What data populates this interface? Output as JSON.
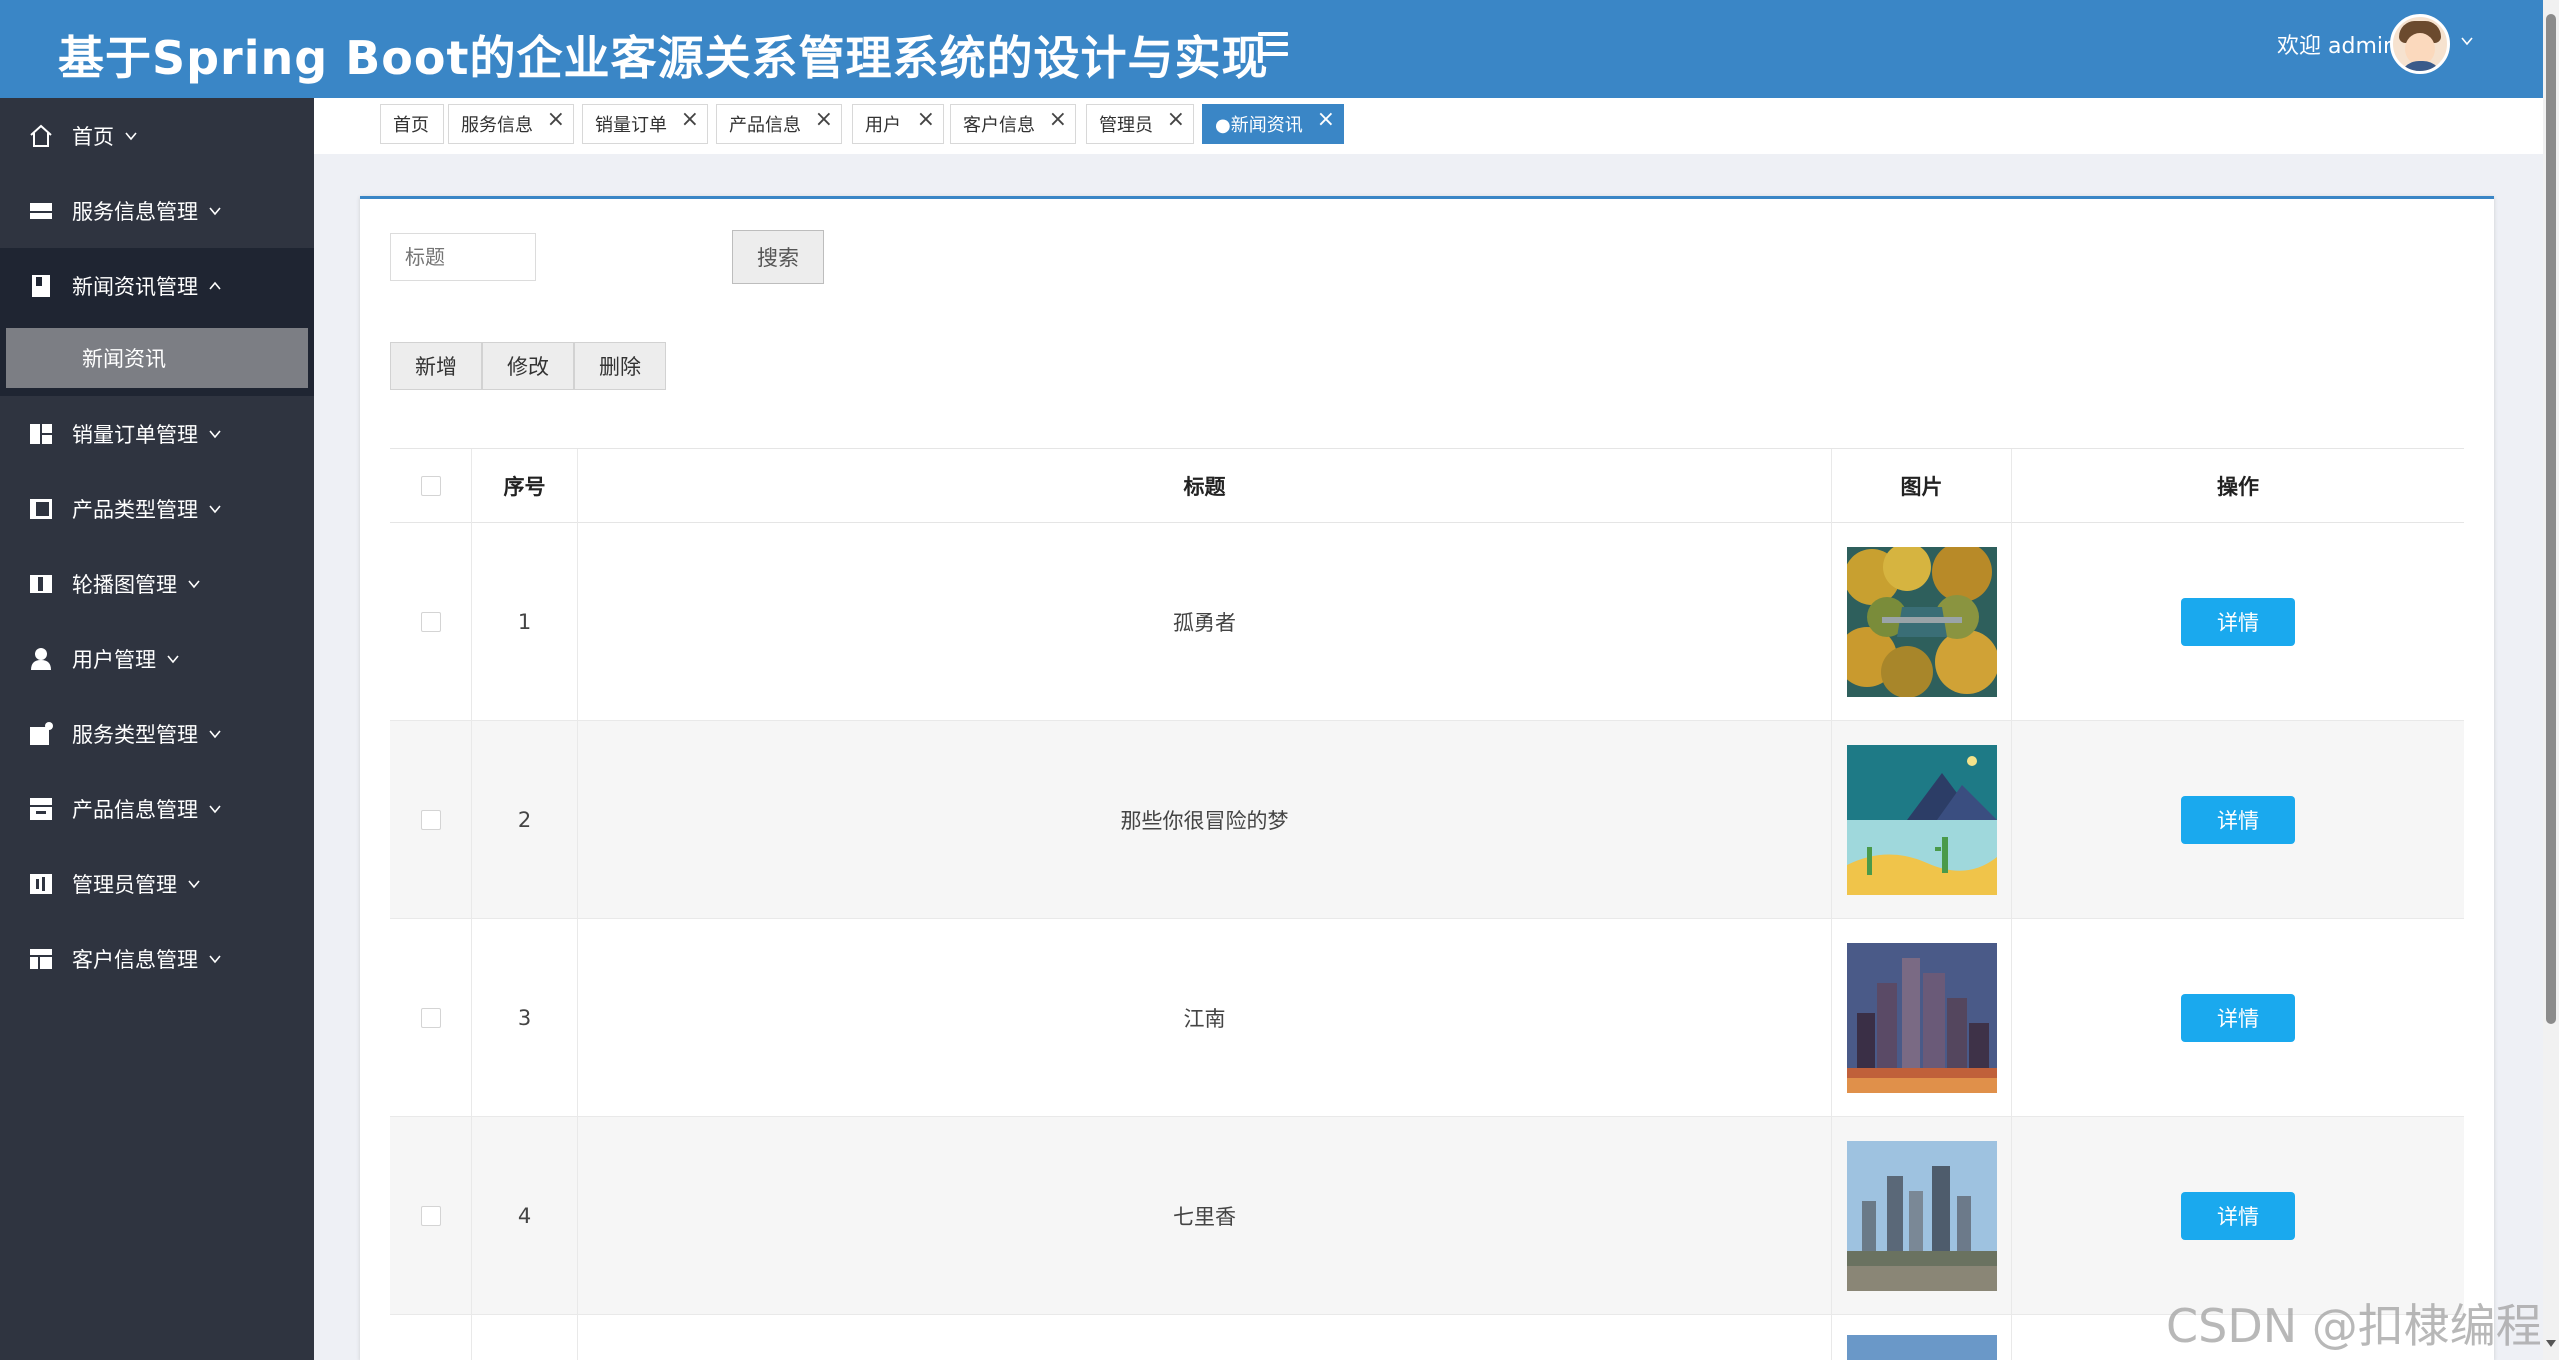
{
  "header": {
    "title": "基于Spring Boot的企业客源关系管理系统的设计与实现",
    "welcome": "欢迎 admin"
  },
  "sidebar": {
    "items": [
      {
        "label": "首页",
        "icon": "home-icon"
      },
      {
        "label": "服务信息管理",
        "icon": "service-info-icon"
      },
      {
        "label": "新闻资讯管理",
        "icon": "news-icon"
      },
      {
        "label": "销量订单管理",
        "icon": "order-icon"
      },
      {
        "label": "产品类型管理",
        "icon": "product-type-icon"
      },
      {
        "label": "轮播图管理",
        "icon": "carousel-icon"
      },
      {
        "label": "用户管理",
        "icon": "user-icon"
      },
      {
        "label": "服务类型管理",
        "icon": "service-type-icon"
      },
      {
        "label": "产品信息管理",
        "icon": "product-info-icon"
      },
      {
        "label": "管理员管理",
        "icon": "admin-icon"
      },
      {
        "label": "客户信息管理",
        "icon": "customer-icon"
      }
    ],
    "sub_item": "新闻资讯"
  },
  "tabs": [
    {
      "label": "首页"
    },
    {
      "label": "服务信息"
    },
    {
      "label": "销量订单"
    },
    {
      "label": "产品信息"
    },
    {
      "label": "用户"
    },
    {
      "label": "客户信息"
    },
    {
      "label": "管理员"
    },
    {
      "label": "●新闻资讯"
    }
  ],
  "search": {
    "placeholder": "标题",
    "button": "搜索"
  },
  "actions": {
    "add": "新增",
    "edit": "修改",
    "delete": "删除"
  },
  "table": {
    "headers": [
      "序号",
      "标题",
      "图片",
      "操作"
    ],
    "rows": [
      {
        "index": "1",
        "title": "孤勇者",
        "image": "forest-road-aerial",
        "action": "详情"
      },
      {
        "index": "2",
        "title": "那些你很冒险的梦",
        "image": "landscape-illustration",
        "action": "详情"
      },
      {
        "index": "3",
        "title": "江南",
        "image": "city-night-skyline",
        "action": "详情"
      },
      {
        "index": "4",
        "title": "七里香",
        "image": "city-skyscrapers-day",
        "action": "详情"
      }
    ]
  },
  "watermark": "CSDN @扣棣编程",
  "colors": {
    "header": "#3a86c6",
    "sidebar": "#2f3440",
    "detail_button": "#1aa9ee"
  }
}
